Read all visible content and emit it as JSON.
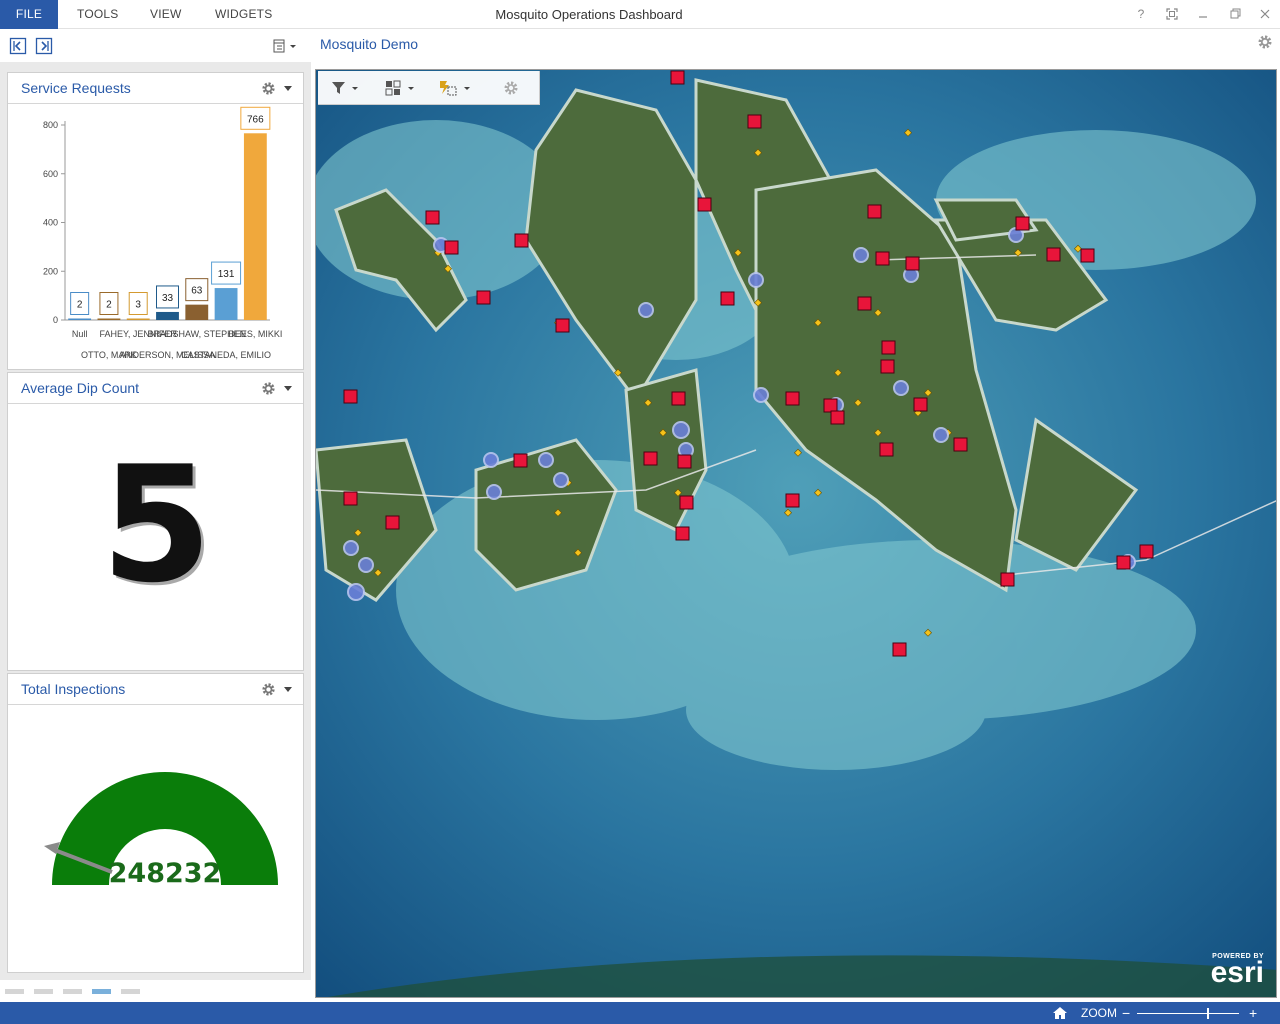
{
  "app": {
    "window_title": "Mosquito Operations Dashboard"
  },
  "menu": {
    "file": "FILE",
    "tools": "TOOLS",
    "view": "VIEW",
    "widgets": "WIDGETS"
  },
  "window_buttons": {
    "help": "?"
  },
  "map": {
    "title": "Mosquito Demo",
    "logo_powered": "POWERED BY",
    "logo_brand": "esri"
  },
  "widgets": {
    "service_requests": {
      "title": "Service Requests"
    },
    "dip_count": {
      "title": "Average Dip Count",
      "value": "5"
    },
    "inspections": {
      "title": "Total Inspections",
      "value": "248232",
      "gauge_color": "#0a7d0a"
    }
  },
  "chart_data": {
    "type": "bar",
    "title": "",
    "xlabel": "",
    "ylabel": "",
    "ylim": [
      0,
      800
    ],
    "yticks": [
      0,
      200,
      400,
      600,
      800
    ],
    "categories": [
      "Null",
      "OTTO, MARK",
      "FAHEY, JENNIFER",
      "ANDERSON, MELISSA",
      "BRADSHAW, STEPHEN",
      "CASTANEDA, EMILIO",
      "DEES, MIKKI"
    ],
    "category_labels": [
      "Null",
      "OTTO, MARK",
      "FAHEY, JENNIFER",
      "ANDERSON, MELISSA",
      "BRADSHAW, STEPHEN",
      "CASTANEDA, EMILIO",
      "DEES, MIKKI"
    ],
    "values": [
      2,
      2,
      3,
      33,
      63,
      131,
      766
    ],
    "colors": [
      "#4a8cc7",
      "#9a6a2a",
      "#d49a30",
      "#1f5a8a",
      "#8a6030",
      "#5a9fd4",
      "#f0a83c"
    ]
  },
  "statusbar": {
    "zoom_label": "ZOOM",
    "zoom_minus": "−",
    "zoom_plus": "+"
  }
}
